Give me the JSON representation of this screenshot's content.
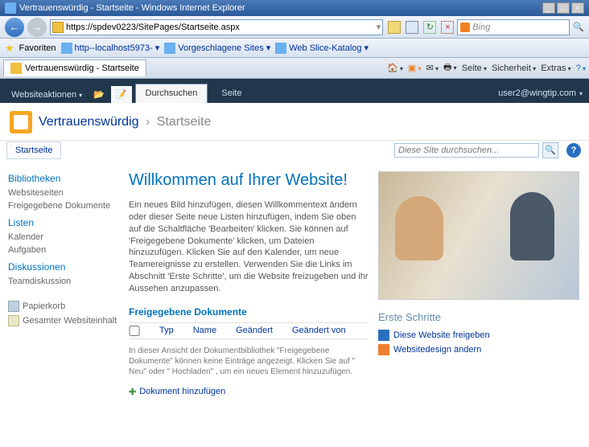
{
  "window": {
    "title": "Vertrauenswürdig - Startseite - Windows Internet Explorer"
  },
  "address": {
    "url": "https://spdev0223/SitePages/Startseite.aspx"
  },
  "search": {
    "engine": "Bing"
  },
  "favorites": {
    "label": "Favoriten",
    "items": [
      "http--localhost5973-",
      "Vorgeschlagene Sites",
      "Web Slice-Katalog"
    ]
  },
  "tab": {
    "title": "Vertrauenswürdig - Startseite"
  },
  "cmdbar": {
    "page": "Seite",
    "security": "Sicherheit",
    "extras": "Extras"
  },
  "ribbon": {
    "siteactions": "Websiteaktionen",
    "browse": "Durchsuchen",
    "page": "Seite",
    "user": "user2@wingtip.com"
  },
  "titlearea": {
    "site": "Vertrauenswürdig",
    "page": "Startseite"
  },
  "topnav": {
    "home": "Startseite"
  },
  "sitesearch": {
    "placeholder": "Diese Site durchsuchen..."
  },
  "quicklaunch": {
    "libs_head": "Bibliotheken",
    "libs": [
      "Websiteseiten",
      "Freigegebene Dokumente"
    ],
    "lists_head": "Listen",
    "lists": [
      "Kalender",
      "Aufgaben"
    ],
    "disc_head": "Diskussionen",
    "disc": [
      "Teamdiskussion"
    ],
    "recycle": "Papierkorb",
    "allcontent": "Gesamter Websiteinhalt"
  },
  "content": {
    "welcome_title": "Willkommen auf Ihrer Website!",
    "welcome_body": "Ein neues Bild hinzufügen, diesen Willkommentext ändern oder dieser Seite neue Listen hinzufügen, indem Sie oben auf die Schaltfläche 'Bearbeiten' klicken. Sie können auf 'Freigegebene Dokumente' klicken, um Dateien hinzuzufügen. Klicken Sie auf den Kalender, um neue Teamereignisse zu erstellen. Verwenden Sie die Links im Abschnitt 'Erste Schritte', um die Website freizugeben und ihr Aussehen anzupassen.",
    "doclib_title": "Freigegebene Dokumente",
    "doclib_cols": {
      "type": "Typ",
      "name": "Name",
      "modified": "Geändert",
      "modified_by": "Geändert von"
    },
    "doclib_empty": "In dieser Ansicht der Dokumentbibliothek \"Freigegebene Dokumente\" können keine Einträge angezeigt. Klicken Sie auf \" Neu\" oder \" Hochladen\" , um ein neues Element hinzuzufügen.",
    "add_doc": "Dokument hinzufügen"
  },
  "steps": {
    "head": "Erste Schritte",
    "items": [
      "Diese Website freigeben",
      "Websitedesign ändern"
    ]
  }
}
